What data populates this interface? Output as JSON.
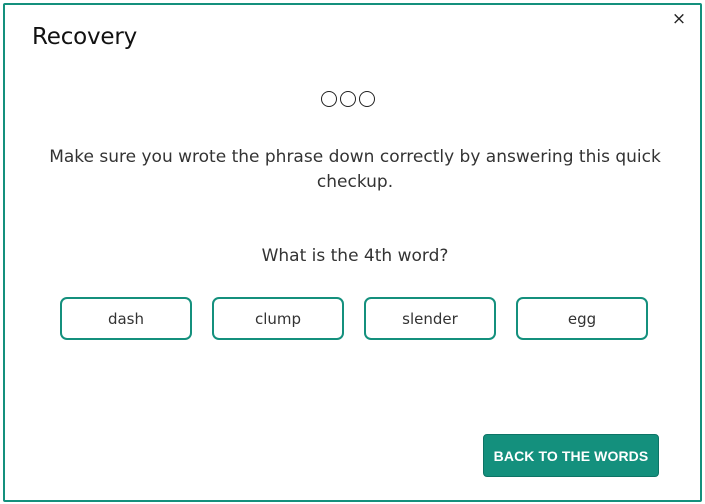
{
  "dialog": {
    "title": "Recovery",
    "close_symbol": "×",
    "progress": {
      "total": 3,
      "completed": 0
    },
    "instructions": "Make sure you wrote the phrase down correctly by answering this quick checkup.",
    "question": "What is the 4th word?",
    "options": [
      {
        "label": "dash"
      },
      {
        "label": "clump"
      },
      {
        "label": "slender"
      },
      {
        "label": "egg"
      }
    ],
    "back_button_label": "BACK TO THE WORDS"
  },
  "colors": {
    "accent": "#14907d",
    "text": "#333333",
    "title": "#111111"
  },
  "icons": {
    "close": "close-icon"
  }
}
